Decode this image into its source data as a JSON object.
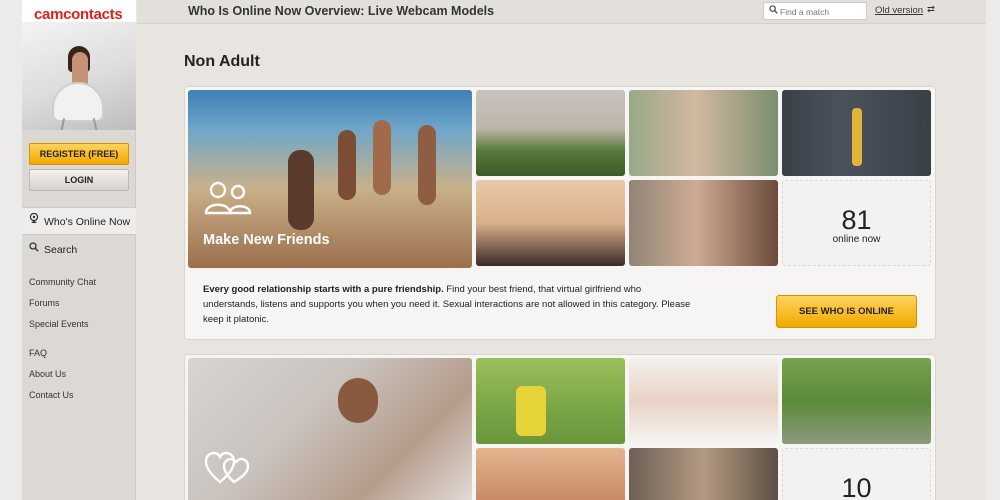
{
  "brand": {
    "part1": "cam",
    "part2": "contacts"
  },
  "sidebar": {
    "register_label": "REGISTER (FREE)",
    "login_label": "LOGIN",
    "main_items": [
      {
        "label": "Who's Online Now",
        "icon": "webcam-icon"
      },
      {
        "label": "Search",
        "icon": "search-icon"
      }
    ],
    "links_group1": [
      "Community Chat",
      "Forums",
      "Special Events"
    ],
    "links_group2": [
      "FAQ",
      "About Us",
      "Contact Us"
    ]
  },
  "header": {
    "title": "Who Is Online Now Overview: Live Webcam Models",
    "search_placeholder": "Find a match",
    "old_version_label": "Old version"
  },
  "section": {
    "heading": "Non Adult"
  },
  "categories": [
    {
      "label": "Make New Friends",
      "icon": "friends-icon",
      "online_count": "81",
      "online_label": "online now",
      "description_bold": "Every good relationship starts with a pure friendship.",
      "description_rest": " Find your best friend, that virtual girlfriend who understands, listens and supports you when you need it. Sexual interactions are not allowed in this category. Please keep it platonic.",
      "cta_label": "SEE WHO IS ONLINE"
    },
    {
      "label": "",
      "icon": "hearts-icon",
      "online_count": "10"
    }
  ],
  "colors": {
    "brand_red": "#e0201c",
    "accent_yellow": "#f2a900",
    "background": "#e8e5e1"
  }
}
